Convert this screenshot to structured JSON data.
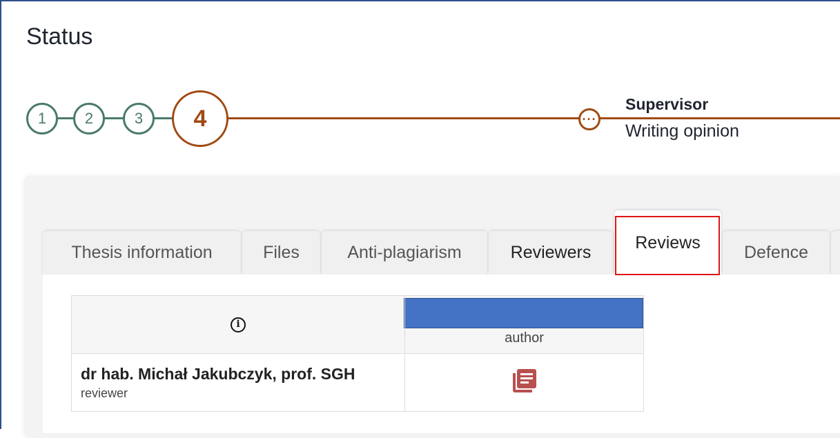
{
  "page": {
    "title": "Status"
  },
  "stepper": {
    "steps": [
      "1",
      "2",
      "3"
    ],
    "current": "4",
    "next": {
      "role": "Supervisor",
      "status": "Writing opinion",
      "icon": "more-dots-icon"
    },
    "colors": {
      "done": "#4a7a6a",
      "current": "#a04a14"
    }
  },
  "tabs": [
    {
      "label": "Thesis information"
    },
    {
      "label": "Files"
    },
    {
      "label": "Anti-plagiarism"
    },
    {
      "label": "Reviewers"
    },
    {
      "label": "Reviews",
      "active": true
    },
    {
      "label": "Defence"
    }
  ],
  "reviews_table": {
    "info_icon": "info-icon",
    "author_label": "author",
    "rows": [
      {
        "name": "dr hab. Michał Jakubczyk, prof. SGH",
        "role": "reviewer",
        "icon": "document-list-icon"
      }
    ]
  },
  "colors": {
    "highlight": "#e01515",
    "accent_bar": "#4472c4",
    "doc_icon": "#b8504e"
  }
}
